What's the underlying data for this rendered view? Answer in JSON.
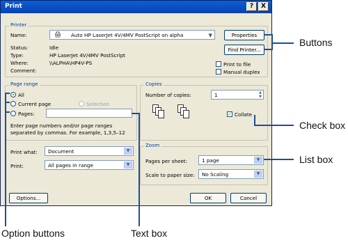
{
  "dialog": {
    "title": "Print",
    "help_button": "?",
    "close_button": "X"
  },
  "printer": {
    "group_label": "Printer",
    "name_label": "Name:",
    "name_value": "Auto HP LaserJet 4V/4MV PostScript on alpha",
    "status_label": "Status:",
    "status_value": "Idle",
    "type_label": "Type:",
    "type_value": "HP LaserJet 4V/4MV PostScript",
    "where_label": "Where:",
    "where_value": "\\\\ALPHA\\HP4V-PS",
    "comment_label": "Comment:",
    "properties_button": "Properties",
    "find_printer_button": "Find Printer...",
    "print_to_file_label": "Print to file",
    "manual_duplex_label": "Manual duplex"
  },
  "page_range": {
    "group_label": "Page range",
    "all_label": "All",
    "current_page_label": "Current page",
    "selection_label": "Selection",
    "pages_label": "Pages:",
    "pages_value": "",
    "hint_line1": "Enter page numbers and/or page ranges",
    "hint_line2": "separated by commas. For example, 1,3,5–12"
  },
  "copies": {
    "group_label": "Copies",
    "number_label": "Number of copies:",
    "number_value": "1",
    "collate_label": "Collate",
    "collate_checked": true
  },
  "print_what": {
    "label": "Print what:",
    "value": "Document"
  },
  "print": {
    "label": "Print:",
    "value": "All pages in range"
  },
  "zoom": {
    "group_label": "Zoom",
    "pages_per_sheet_label": "Pages per sheet:",
    "pages_per_sheet_value": "1 page",
    "scale_label": "Scale to paper size:",
    "scale_value": "No Scaling"
  },
  "footer": {
    "options_button": "Options...",
    "ok_button": "OK",
    "cancel_button": "Cancel"
  },
  "callouts": {
    "buttons": "Buttons",
    "check_box": "Check box",
    "list_box": "List box",
    "option_buttons": "Option buttons",
    "text_box": "Text box"
  },
  "colors": {
    "callout_line": "#1f4c9a",
    "titlebar": "#0a5fd8",
    "dialog_bg": "#ece9d8"
  }
}
